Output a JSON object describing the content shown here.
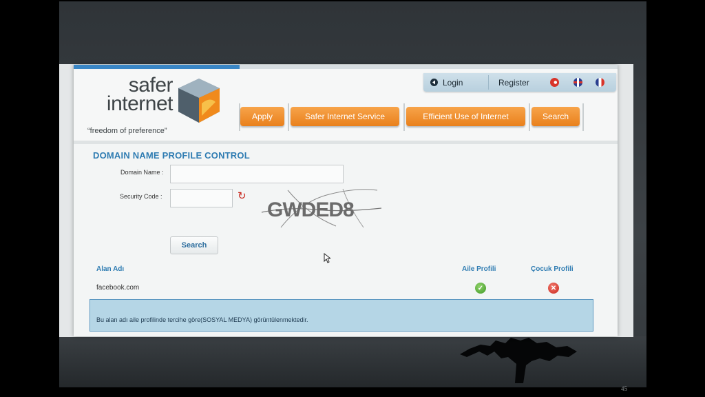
{
  "logo": {
    "line1": "safer",
    "line2": "internet",
    "tagline": "“freedom of preference”"
  },
  "auth": {
    "login_label": "Login",
    "register_label": "Register"
  },
  "flags": [
    {
      "name": "turkish-flag",
      "color": "#d8342a"
    },
    {
      "name": "uk-flag",
      "color": "#2a3f8f"
    },
    {
      "name": "french-flag",
      "color": "#d8342a"
    }
  ],
  "nav": [
    {
      "label": "Apply"
    },
    {
      "label": "Safer Internet Service"
    },
    {
      "label": "Efficient Use of Internet"
    },
    {
      "label": "Search"
    }
  ],
  "form": {
    "title": "DOMAIN NAME PROFILE CONTROL",
    "domain_label": "Domain Name :",
    "domain_value": "",
    "security_label": "Security Code :",
    "security_value": "",
    "captcha_text": "GWDED8",
    "search_label": "Search"
  },
  "results": {
    "headers": [
      "Alan Adı",
      "Aile Profili",
      "Çocuk Profili"
    ],
    "rows": [
      {
        "domain": "facebook.com",
        "aile": "allowed",
        "cocuk": "blocked"
      }
    ],
    "info": "Bu alan adı aile profilinde tercihe göre(SOSYAL MEDYA) görüntülenmektedir."
  },
  "colors": {
    "accent": "#2f7cb2",
    "nav_orange": "#ee8a26",
    "allowed": "#4aa52e",
    "blocked": "#d8342a"
  },
  "slide": {
    "page_number": "45"
  }
}
